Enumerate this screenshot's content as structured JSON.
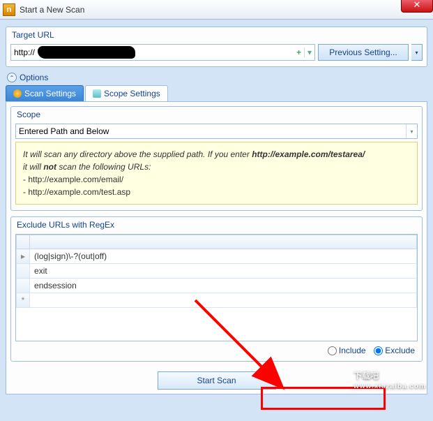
{
  "window": {
    "title": "Start a New Scan",
    "close_glyph": "✕"
  },
  "target": {
    "group_title": "Target URL",
    "protocol": "http://",
    "plus": "+",
    "dd": "▾",
    "prev_btn": "Previous Setting...",
    "prev_dd": "▾"
  },
  "options": {
    "header": "Options",
    "chev": "⌃"
  },
  "tabs": {
    "scan": "Scan Settings",
    "scope": "Scope Settings"
  },
  "scope": {
    "group_title": "Scope",
    "select_value": "Entered Path and Below",
    "dd": "▾",
    "info_line1_a": "It will scan any directory above the supplied path. If you enter ",
    "info_line1_b": "http://example.com/testarea/",
    "info_line2_a": "it will ",
    "info_line2_b": "not",
    "info_line2_c": " scan the following URLs:",
    "info_url1": " - http://example.com/email/",
    "info_url2": " - http://example.com/test.asp"
  },
  "exclude": {
    "group_title": "Exclude URLs with RegEx",
    "rows": [
      "(log|sign)\\-?(out|off)",
      "exit",
      "endsession"
    ],
    "rowmark0": "▸",
    "rowmark_new": "*",
    "include_label": "Include",
    "exclude_label": "Exclude"
  },
  "start": {
    "button": "Start Scan"
  },
  "watermark": {
    "main": "下载吧",
    "sub": "www.xiazaiba.com"
  }
}
